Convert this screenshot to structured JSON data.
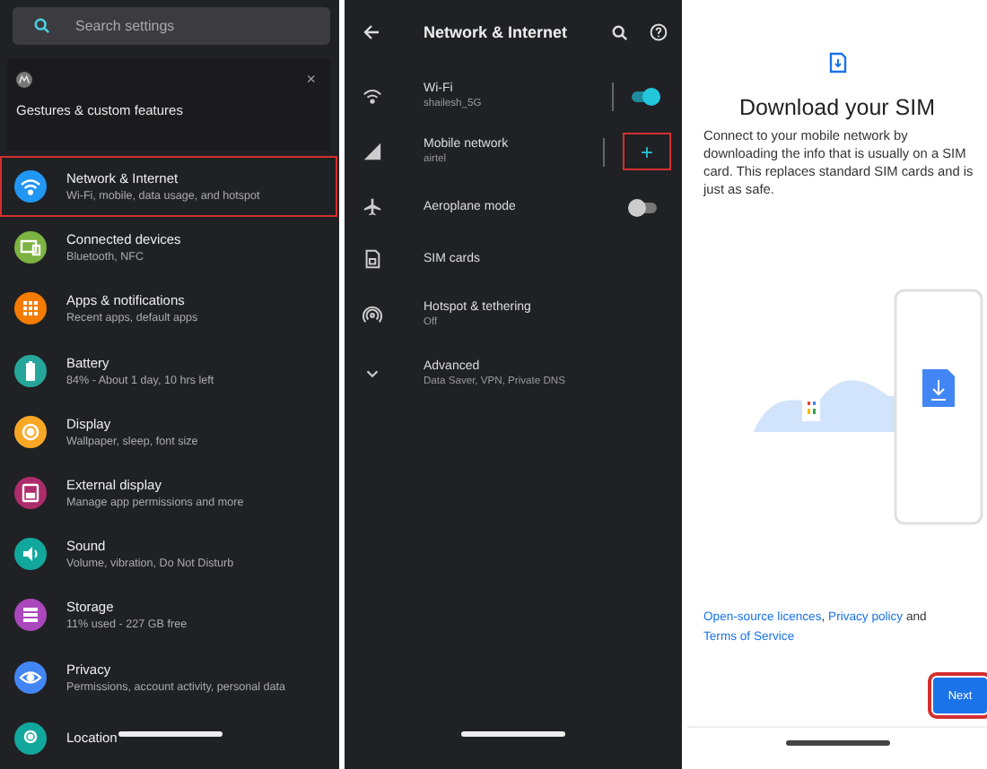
{
  "settings_panel": {
    "search": {
      "placeholder": "Search settings"
    },
    "suggestion_card": {
      "title": "Gestures & custom features",
      "close": "×"
    },
    "items": [
      {
        "title": "Network & Internet",
        "subtitle": "Wi-Fi, mobile, data usage, and hotspot",
        "color": "#2196f3",
        "highlighted": true
      },
      {
        "title": "Connected devices",
        "subtitle": "Bluetooth, NFC",
        "color": "#7cb342",
        "highlighted": false
      },
      {
        "title": "Apps & notifications",
        "subtitle": "Recent apps, default apps",
        "color": "#f57c00",
        "highlighted": false
      },
      {
        "title": "Battery",
        "subtitle": "84% - About 1 day, 10 hrs left",
        "color": "#26a69a",
        "highlighted": false
      },
      {
        "title": "Display",
        "subtitle": "Wallpaper, sleep, font size",
        "color": "#f9a825",
        "highlighted": false
      },
      {
        "title": "External display",
        "subtitle": "Manage app permissions and more",
        "color": "#ad2c6b",
        "highlighted": false
      },
      {
        "title": "Sound",
        "subtitle": "Volume, vibration, Do Not Disturb",
        "color": "#12a79d",
        "highlighted": false
      },
      {
        "title": "Storage",
        "subtitle": "11% used - 227 GB free",
        "color": "#ab47bc",
        "highlighted": false
      },
      {
        "title": "Privacy",
        "subtitle": "Permissions, account activity, personal data",
        "color": "#4285f4",
        "highlighted": false
      },
      {
        "title": "Location",
        "color": "#12a79d",
        "highlighted": false
      }
    ]
  },
  "network_panel": {
    "title": "Network & Internet",
    "items": [
      {
        "kind": "toggle",
        "title": "Wi-Fi",
        "subtitle": "shailesh_5G",
        "on": true
      },
      {
        "kind": "add",
        "title": "Mobile network",
        "subtitle": "airtel",
        "add_label": "+",
        "highlighted": true
      },
      {
        "kind": "toggle",
        "title": "Aeroplane mode",
        "on": false
      },
      {
        "kind": "plain",
        "title": "SIM cards"
      },
      {
        "kind": "plain",
        "title": "Hotspot & tethering",
        "subtitle": "Off"
      },
      {
        "kind": "plain",
        "title": "Advanced",
        "subtitle": "Data Saver, VPN, Private DNS"
      }
    ]
  },
  "sim_panel": {
    "title": "Download your SIM",
    "body": "Connect to your mobile network by downloading the info that is usually on a SIM card. This replaces standard SIM cards and is just as safe.",
    "links": [
      "Open-source licences",
      "Privacy policy",
      "Terms of Service"
    ],
    "joiners": [
      ", ",
      " and "
    ],
    "next_button": {
      "label": "Next",
      "highlighted": true
    }
  }
}
